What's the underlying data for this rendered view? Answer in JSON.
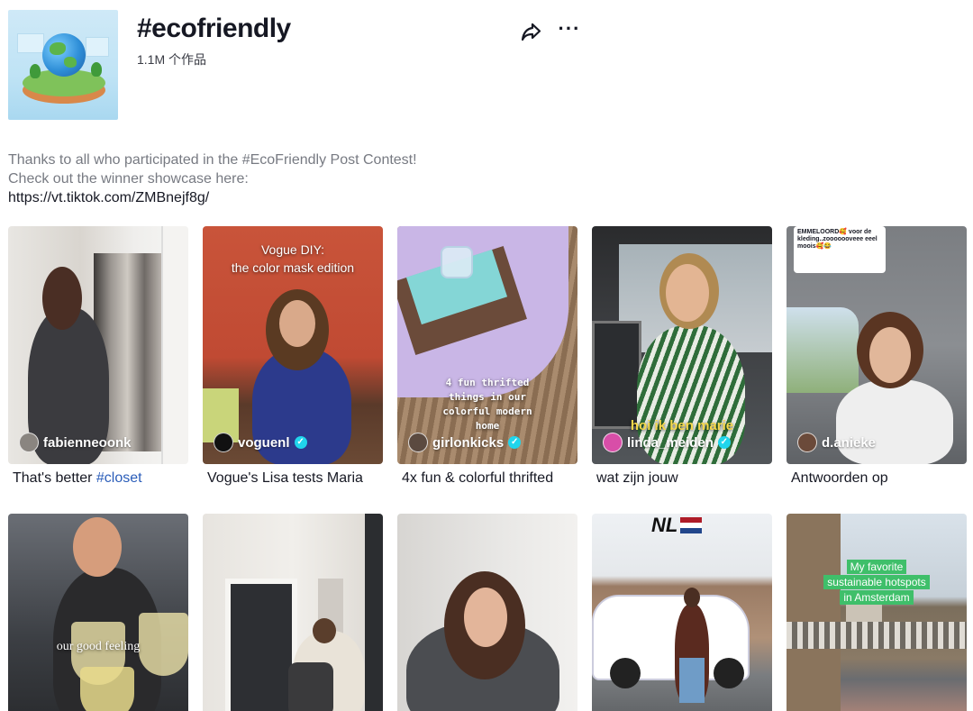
{
  "hashtag": {
    "title": "#ecofriendly",
    "count": "1.1M 个作品",
    "cover_icon": "earth-globe-island-icon"
  },
  "toolbar": {
    "share_icon": "share-arrow-icon",
    "more_icon": "ellipsis-icon",
    "more_label": "···"
  },
  "description": {
    "line1": "Thanks to all who participated in the #EcoFriendly Post Contest!",
    "line2": "Check out the winner showcase here:",
    "link": "https://vt.tiktok.com/ZMBnejf8g/"
  },
  "videos_row1": [
    {
      "author": "fabienneoonk",
      "verified": false,
      "caption_text": "That's better ",
      "caption_tag": "#closet",
      "overlay": ""
    },
    {
      "author": "voguenl",
      "verified": true,
      "caption_text": "Vogue's Lisa tests Maria",
      "caption_tag": "",
      "overlay": "Vogue DIY:\nthe color mask edition"
    },
    {
      "author": "girlonkicks",
      "verified": true,
      "caption_text": "4x fun & colorful thrifted",
      "caption_tag": "",
      "overlay": "4 fun thrifted\nthings in our\ncolorful modern\nhome"
    },
    {
      "author": "linda_meiden",
      "verified": true,
      "caption_text": "wat zijn jouw",
      "caption_tag": "",
      "overlay": "hoi ik ben marie"
    },
    {
      "author": "d.anieke",
      "verified": false,
      "caption_text": "Antwoorden op",
      "caption_tag": "",
      "overlay": "EMMELOORD🥰 voor de kleding..zooooooveee eeel moois🥰😂"
    }
  ],
  "videos_row2": [
    {
      "overlay": "our good feeling"
    },
    {
      "overlay": ""
    },
    {
      "overlay": ""
    },
    {
      "overlay": "NL"
    },
    {
      "overlay": "My favorite\nsustainable hotspots\nin Amsterdam"
    }
  ],
  "colors": {
    "link_blue": "#2b5db9",
    "verified": "#20d5ec",
    "muted_text": "#777a82"
  }
}
